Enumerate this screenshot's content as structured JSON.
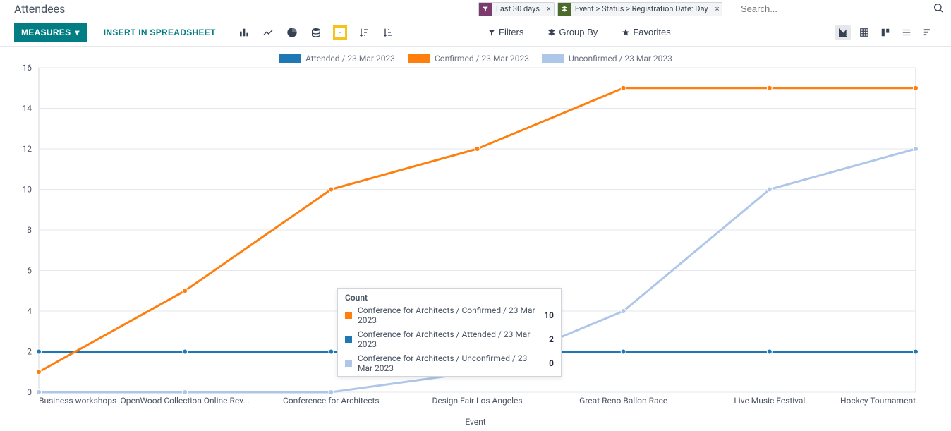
{
  "header": {
    "title": "Attendees"
  },
  "search": {
    "placeholder": "Search...",
    "facets": [
      {
        "kind": "filter",
        "label": "Last 30 days"
      },
      {
        "kind": "group",
        "label": "Event > Status > Registration Date: Day"
      }
    ]
  },
  "toolbar": {
    "measures_label": "MEASURES",
    "insert_label": "INSERT IN SPREADSHEET",
    "filters_label": "Filters",
    "groupby_label": "Group By",
    "favorites_label": "Favorites"
  },
  "chart_data": {
    "type": "line",
    "xlabel": "Event",
    "ylabel": "",
    "ylim": [
      0,
      16
    ],
    "yticks": [
      0,
      2,
      4,
      6,
      8,
      10,
      12,
      14,
      16
    ],
    "categories": [
      "Business workshops",
      "OpenWood Collection Online Rev...",
      "Conference for Architects",
      "Design Fair Los Angeles",
      "Great Reno Ballon Race",
      "Live Music Festival",
      "Hockey Tournament"
    ],
    "series": [
      {
        "name": "Attended / 23 Mar 2023",
        "color": "#1f77b4",
        "values": [
          2,
          2,
          2,
          2,
          2,
          2,
          2
        ]
      },
      {
        "name": "Confirmed / 23 Mar 2023",
        "color": "#ff7f0e",
        "values": [
          1,
          5,
          10,
          12,
          15,
          15,
          15
        ]
      },
      {
        "name": "Unconfirmed / 23 Mar 2023",
        "color": "#aec7e8",
        "values": [
          0,
          0,
          0,
          1,
          4,
          10,
          12
        ]
      }
    ]
  },
  "tooltip": {
    "title": "Count",
    "rows": [
      {
        "color": "#ff7f0e",
        "label": "Conference for Architects / Confirmed / 23 Mar 2023",
        "value": "10"
      },
      {
        "color": "#1f77b4",
        "label": "Conference for Architects / Attended / 23 Mar 2023",
        "value": "2"
      },
      {
        "color": "#aec7e8",
        "label": "Conference for Architects / Unconfirmed / 23 Mar 2023",
        "value": "0"
      }
    ]
  },
  "colors": {
    "accent": "#017e84",
    "highlight": "#f6c21c"
  }
}
